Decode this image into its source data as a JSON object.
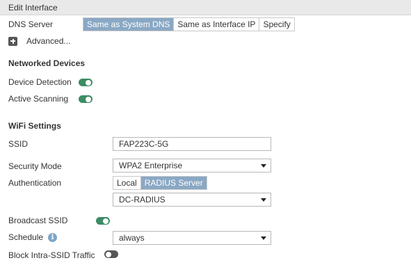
{
  "header": {
    "title": "Edit Interface"
  },
  "dns": {
    "label": "DNS Server",
    "options": [
      "Same as System DNS",
      "Same as Interface IP",
      "Specify"
    ],
    "selected": "Same as System DNS"
  },
  "advanced": {
    "label": "Advanced..."
  },
  "networked_devices": {
    "title": "Networked Devices",
    "device_detection": {
      "label": "Device Detection",
      "enabled": true
    },
    "active_scanning": {
      "label": "Active Scanning",
      "enabled": true
    }
  },
  "wifi": {
    "title": "WiFi Settings",
    "ssid": {
      "label": "SSID",
      "value": "FAP223C-5G"
    },
    "security_mode": {
      "label": "Security Mode",
      "value": "WPA2 Enterprise"
    },
    "authentication": {
      "label": "Authentication",
      "options": [
        "Local",
        "RADIUS Server"
      ],
      "selected": "RADIUS Server",
      "radius_server": "DC-RADIUS"
    },
    "broadcast_ssid": {
      "label": "Broadcast SSID",
      "enabled": true
    },
    "schedule": {
      "label": "Schedule",
      "value": "always",
      "info_icon": "i"
    },
    "block_intra_ssid": {
      "label": "Block Intra-SSID Traffic",
      "enabled": false
    }
  },
  "colors": {
    "accent": "#8aa8c4",
    "toggle_on": "#3c8c64",
    "toggle_off": "#555555",
    "header_bg": "#e9e9e9"
  }
}
